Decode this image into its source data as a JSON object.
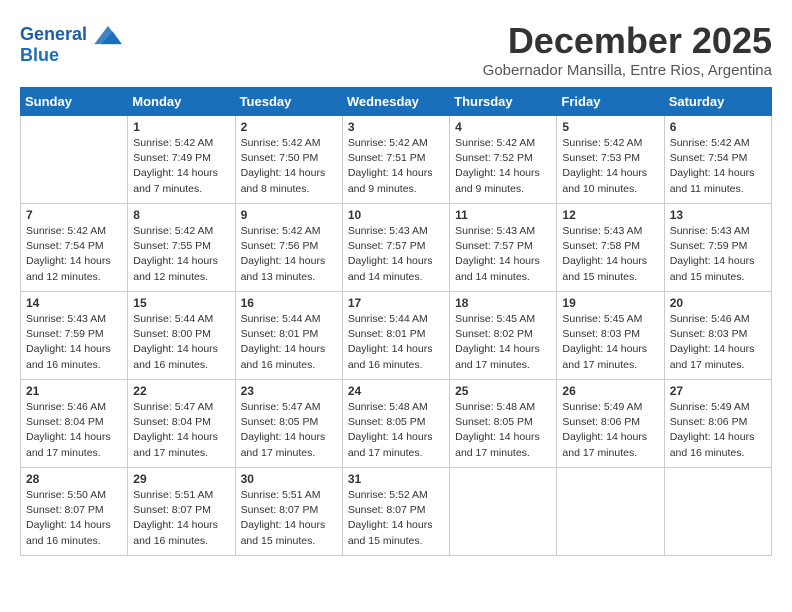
{
  "logo": {
    "line1": "General",
    "line2": "Blue"
  },
  "title": {
    "month_year": "December 2025",
    "location": "Gobernador Mansilla, Entre Rios, Argentina"
  },
  "headers": [
    "Sunday",
    "Monday",
    "Tuesday",
    "Wednesday",
    "Thursday",
    "Friday",
    "Saturday"
  ],
  "weeks": [
    [
      {
        "day": "",
        "sunrise": "",
        "sunset": "",
        "daylight": ""
      },
      {
        "day": "1",
        "sunrise": "Sunrise: 5:42 AM",
        "sunset": "Sunset: 7:49 PM",
        "daylight": "Daylight: 14 hours and 7 minutes."
      },
      {
        "day": "2",
        "sunrise": "Sunrise: 5:42 AM",
        "sunset": "Sunset: 7:50 PM",
        "daylight": "Daylight: 14 hours and 8 minutes."
      },
      {
        "day": "3",
        "sunrise": "Sunrise: 5:42 AM",
        "sunset": "Sunset: 7:51 PM",
        "daylight": "Daylight: 14 hours and 9 minutes."
      },
      {
        "day": "4",
        "sunrise": "Sunrise: 5:42 AM",
        "sunset": "Sunset: 7:52 PM",
        "daylight": "Daylight: 14 hours and 9 minutes."
      },
      {
        "day": "5",
        "sunrise": "Sunrise: 5:42 AM",
        "sunset": "Sunset: 7:53 PM",
        "daylight": "Daylight: 14 hours and 10 minutes."
      },
      {
        "day": "6",
        "sunrise": "Sunrise: 5:42 AM",
        "sunset": "Sunset: 7:54 PM",
        "daylight": "Daylight: 14 hours and 11 minutes."
      }
    ],
    [
      {
        "day": "7",
        "sunrise": "Sunrise: 5:42 AM",
        "sunset": "Sunset: 7:54 PM",
        "daylight": "Daylight: 14 hours and 12 minutes."
      },
      {
        "day": "8",
        "sunrise": "Sunrise: 5:42 AM",
        "sunset": "Sunset: 7:55 PM",
        "daylight": "Daylight: 14 hours and 12 minutes."
      },
      {
        "day": "9",
        "sunrise": "Sunrise: 5:42 AM",
        "sunset": "Sunset: 7:56 PM",
        "daylight": "Daylight: 14 hours and 13 minutes."
      },
      {
        "day": "10",
        "sunrise": "Sunrise: 5:43 AM",
        "sunset": "Sunset: 7:57 PM",
        "daylight": "Daylight: 14 hours and 14 minutes."
      },
      {
        "day": "11",
        "sunrise": "Sunrise: 5:43 AM",
        "sunset": "Sunset: 7:57 PM",
        "daylight": "Daylight: 14 hours and 14 minutes."
      },
      {
        "day": "12",
        "sunrise": "Sunrise: 5:43 AM",
        "sunset": "Sunset: 7:58 PM",
        "daylight": "Daylight: 14 hours and 15 minutes."
      },
      {
        "day": "13",
        "sunrise": "Sunrise: 5:43 AM",
        "sunset": "Sunset: 7:59 PM",
        "daylight": "Daylight: 14 hours and 15 minutes."
      }
    ],
    [
      {
        "day": "14",
        "sunrise": "Sunrise: 5:43 AM",
        "sunset": "Sunset: 7:59 PM",
        "daylight": "Daylight: 14 hours and 16 minutes."
      },
      {
        "day": "15",
        "sunrise": "Sunrise: 5:44 AM",
        "sunset": "Sunset: 8:00 PM",
        "daylight": "Daylight: 14 hours and 16 minutes."
      },
      {
        "day": "16",
        "sunrise": "Sunrise: 5:44 AM",
        "sunset": "Sunset: 8:01 PM",
        "daylight": "Daylight: 14 hours and 16 minutes."
      },
      {
        "day": "17",
        "sunrise": "Sunrise: 5:44 AM",
        "sunset": "Sunset: 8:01 PM",
        "daylight": "Daylight: 14 hours and 16 minutes."
      },
      {
        "day": "18",
        "sunrise": "Sunrise: 5:45 AM",
        "sunset": "Sunset: 8:02 PM",
        "daylight": "Daylight: 14 hours and 17 minutes."
      },
      {
        "day": "19",
        "sunrise": "Sunrise: 5:45 AM",
        "sunset": "Sunset: 8:03 PM",
        "daylight": "Daylight: 14 hours and 17 minutes."
      },
      {
        "day": "20",
        "sunrise": "Sunrise: 5:46 AM",
        "sunset": "Sunset: 8:03 PM",
        "daylight": "Daylight: 14 hours and 17 minutes."
      }
    ],
    [
      {
        "day": "21",
        "sunrise": "Sunrise: 5:46 AM",
        "sunset": "Sunset: 8:04 PM",
        "daylight": "Daylight: 14 hours and 17 minutes."
      },
      {
        "day": "22",
        "sunrise": "Sunrise: 5:47 AM",
        "sunset": "Sunset: 8:04 PM",
        "daylight": "Daylight: 14 hours and 17 minutes."
      },
      {
        "day": "23",
        "sunrise": "Sunrise: 5:47 AM",
        "sunset": "Sunset: 8:05 PM",
        "daylight": "Daylight: 14 hours and 17 minutes."
      },
      {
        "day": "24",
        "sunrise": "Sunrise: 5:48 AM",
        "sunset": "Sunset: 8:05 PM",
        "daylight": "Daylight: 14 hours and 17 minutes."
      },
      {
        "day": "25",
        "sunrise": "Sunrise: 5:48 AM",
        "sunset": "Sunset: 8:05 PM",
        "daylight": "Daylight: 14 hours and 17 minutes."
      },
      {
        "day": "26",
        "sunrise": "Sunrise: 5:49 AM",
        "sunset": "Sunset: 8:06 PM",
        "daylight": "Daylight: 14 hours and 17 minutes."
      },
      {
        "day": "27",
        "sunrise": "Sunrise: 5:49 AM",
        "sunset": "Sunset: 8:06 PM",
        "daylight": "Daylight: 14 hours and 16 minutes."
      }
    ],
    [
      {
        "day": "28",
        "sunrise": "Sunrise: 5:50 AM",
        "sunset": "Sunset: 8:07 PM",
        "daylight": "Daylight: 14 hours and 16 minutes."
      },
      {
        "day": "29",
        "sunrise": "Sunrise: 5:51 AM",
        "sunset": "Sunset: 8:07 PM",
        "daylight": "Daylight: 14 hours and 16 minutes."
      },
      {
        "day": "30",
        "sunrise": "Sunrise: 5:51 AM",
        "sunset": "Sunset: 8:07 PM",
        "daylight": "Daylight: 14 hours and 15 minutes."
      },
      {
        "day": "31",
        "sunrise": "Sunrise: 5:52 AM",
        "sunset": "Sunset: 8:07 PM",
        "daylight": "Daylight: 14 hours and 15 minutes."
      },
      {
        "day": "",
        "sunrise": "",
        "sunset": "",
        "daylight": ""
      },
      {
        "day": "",
        "sunrise": "",
        "sunset": "",
        "daylight": ""
      },
      {
        "day": "",
        "sunrise": "",
        "sunset": "",
        "daylight": ""
      }
    ]
  ]
}
